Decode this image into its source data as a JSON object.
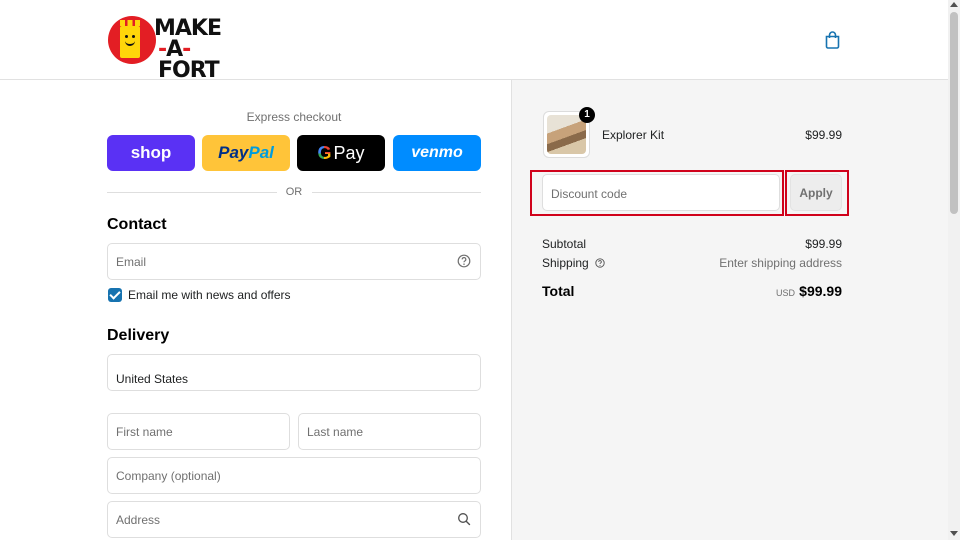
{
  "header": {
    "logo_line1": "MAKE",
    "logo_line2_dash1": "-",
    "logo_line2_a": "A",
    "logo_line2_dash2": "-",
    "logo_line2_fort": "FORT",
    "cart_icon": "shopping-bag-icon"
  },
  "express": {
    "title": "Express checkout",
    "shop_label": "shop",
    "paypal_label_1": "Pay",
    "paypal_label_2": "Pal",
    "gpay_g": "G",
    "gpay_label": "Pay",
    "venmo_label": "venmo",
    "or_label": "OR"
  },
  "contact": {
    "title": "Contact",
    "email_placeholder": "Email",
    "newsletter_label": "Email me with news and offers",
    "newsletter_checked": true
  },
  "delivery": {
    "title": "Delivery",
    "country_value": "United States",
    "first_name_placeholder": "First name",
    "last_name_placeholder": "Last name",
    "company_placeholder": "Company (optional)",
    "address_placeholder": "Address"
  },
  "summary": {
    "item": {
      "name": "Explorer Kit",
      "price": "$99.99",
      "quantity": "1"
    },
    "discount_placeholder": "Discount code",
    "apply_label": "Apply",
    "subtotal_label": "Subtotal",
    "subtotal_value": "$99.99",
    "shipping_label": "Shipping",
    "shipping_value": "Enter shipping address",
    "total_label": "Total",
    "total_currency": "USD",
    "total_value": "$99.99"
  },
  "colors": {
    "shop": "#5a31f4",
    "paypal": "#ffc439",
    "gpay": "#000000",
    "venmo": "#008cff",
    "checkbox": "#1773b0",
    "highlight": "#d0021b"
  }
}
